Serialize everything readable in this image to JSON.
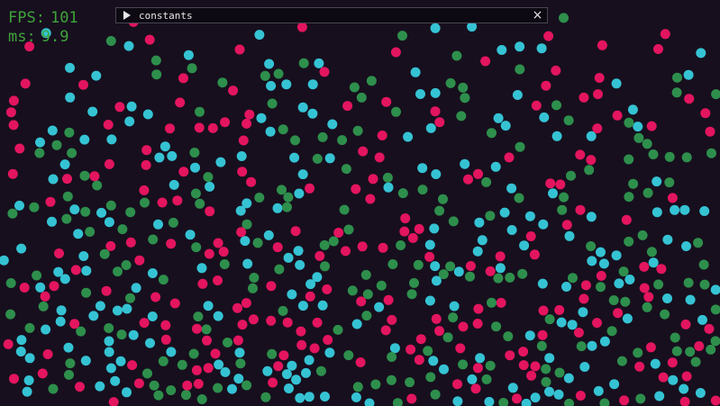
{
  "overlay": {
    "fps_label": "FPS:",
    "fps_value": "101",
    "ms_label": "ms:",
    "ms_value": "9.9"
  },
  "panel": {
    "title": "constants",
    "close_glyph": "×",
    "toggle_icon": "play-triangle-icon"
  },
  "colors": {
    "background": "#170f1e",
    "particle_pink": "#e3155f",
    "particle_cyan": "#35c3d4",
    "particle_green": "#2e8f4c",
    "stats_text": "#3fa33a"
  }
}
